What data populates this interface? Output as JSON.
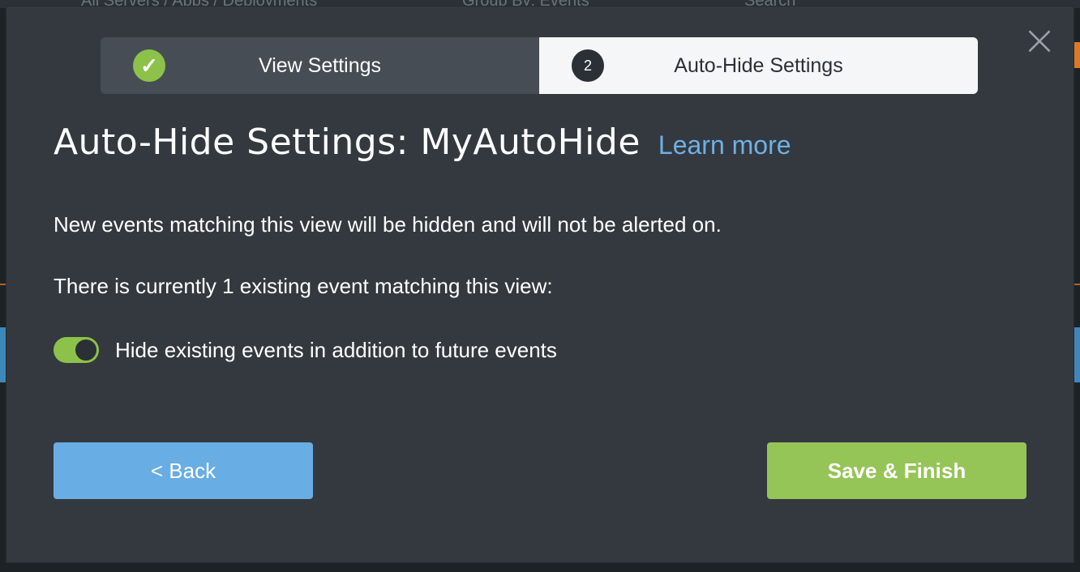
{
  "background": {
    "topbar": {
      "scope_label": "All Servers / Apps / Deployments",
      "group_label": "Group By: Events",
      "search_placeholder": "Search"
    }
  },
  "modal": {
    "stepper": {
      "steps": [
        {
          "label": "View Settings",
          "status": "complete",
          "badge": "✓"
        },
        {
          "label": "Auto-Hide Settings",
          "status": "active",
          "badge": "2"
        }
      ]
    },
    "title": "Auto-Hide Settings: MyAutoHide",
    "learn_more": "Learn more",
    "description": "New events matching this view will be hidden and will not be alerted on.",
    "existing_count_text": "There is currently 1 existing event matching this view:",
    "toggle": {
      "label": "Hide existing events in addition to future events",
      "checked": true
    },
    "back_button": "< Back",
    "save_button": "Save & Finish",
    "close_icon": "×"
  },
  "colors": {
    "modal_bg": "#33393f",
    "accent_green": "#8cc24a",
    "accent_blue": "#68ade3",
    "link_blue": "#6fb0e6"
  }
}
